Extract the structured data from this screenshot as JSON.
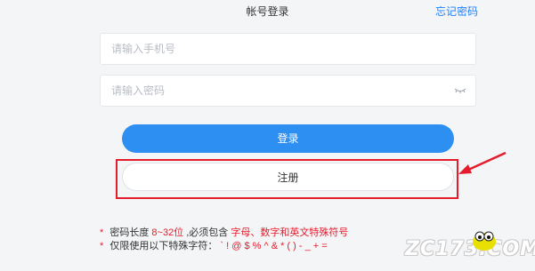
{
  "header": {
    "title": "帐号登录",
    "forgot_link": "忘记密码"
  },
  "form": {
    "phone_placeholder": "请输入手机号",
    "password_placeholder": "请输入密码",
    "password_toggle_icon": "eye-closed-icon",
    "login_label": "登录",
    "register_label": "注册"
  },
  "annotation": {
    "highlight_color": "#e41c2b",
    "arrow_icon": "red-arrow-icon"
  },
  "rules": {
    "star": "*",
    "line1_prefix": "密码长度",
    "line1_length": "8~32位",
    "line1_middle": ",必须包含",
    "line1_required": "字母、数字和英文特殊符号",
    "line2_prefix": "仅限使用以下特殊字符：",
    "line2_chars": "` ! @ $ % ^ & * ( ) - _ + ="
  },
  "watermark": {
    "text": "ZC173.COM"
  },
  "colors": {
    "accent": "#2e8ff3",
    "link": "#1e80ff",
    "warning": "#e41c2b"
  }
}
